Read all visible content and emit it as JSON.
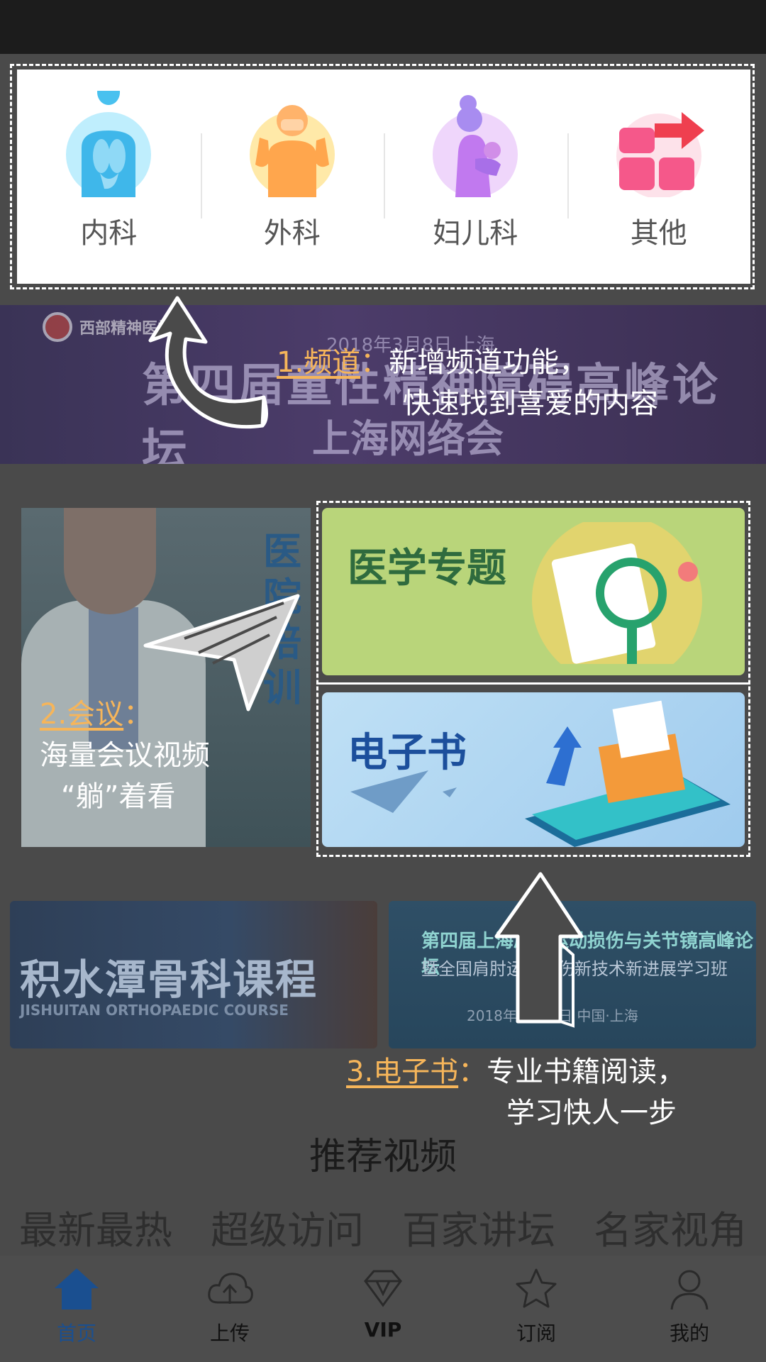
{
  "channels": [
    {
      "label": "内科",
      "icon": "internal-medicine-icon"
    },
    {
      "label": "外科",
      "icon": "surgery-icon"
    },
    {
      "label": "妇儿科",
      "icon": "gynecology-pediatrics-icon"
    },
    {
      "label": "其他",
      "icon": "other-icon"
    }
  ],
  "banner": {
    "org": "西部精神医学",
    "date": "2018年3月8日 上海",
    "title": "第四届童性精神障碍高峰论坛",
    "subtitle": "上海网络会"
  },
  "annotations": {
    "channel": {
      "key": "1.频道",
      "colon": "：",
      "line1": "新增频道功能，",
      "line2": "快速找到喜爱的内容"
    },
    "meeting": {
      "key": "2.会议",
      "colon": "：",
      "line1": "海量会议视频",
      "line2": "“躺”着看"
    },
    "ebook": {
      "key": "3.电子书",
      "colon": "：",
      "line1": "专业书籍阅读，",
      "line2": "学习快人一步"
    }
  },
  "conference_tile": {
    "vertical_text": "医院培训"
  },
  "topics": {
    "medical": "医学专题",
    "ebook": "电子书"
  },
  "course": {
    "title": "积水潭骨科课程",
    "subtitle": "JISHUITAN ORTHOPAEDIC COURSE"
  },
  "forum": {
    "title": "第四届上海肩肘运动损伤与关节镜高峰论坛",
    "subtitle": "暨全国肩肘运动损伤新技术新进展学习班",
    "date": "2018年5月28日 中国·上海"
  },
  "recommended": {
    "title": "推荐视频",
    "tabs": [
      "最新最热",
      "超级访问",
      "百家讲坛",
      "名家视角"
    ]
  },
  "nav": [
    {
      "label": "首页",
      "icon": "home-icon",
      "active": true
    },
    {
      "label": "上传",
      "icon": "upload-cloud-icon",
      "active": false
    },
    {
      "label": "VIP",
      "icon": "diamond-icon",
      "active": false
    },
    {
      "label": "订阅",
      "icon": "star-icon",
      "active": false
    },
    {
      "label": "我的",
      "icon": "user-icon",
      "active": false
    }
  ],
  "colors": {
    "accent": "#1a4f90",
    "annotation_key": "#f6b55a",
    "overlay": "#4a4a4a"
  }
}
